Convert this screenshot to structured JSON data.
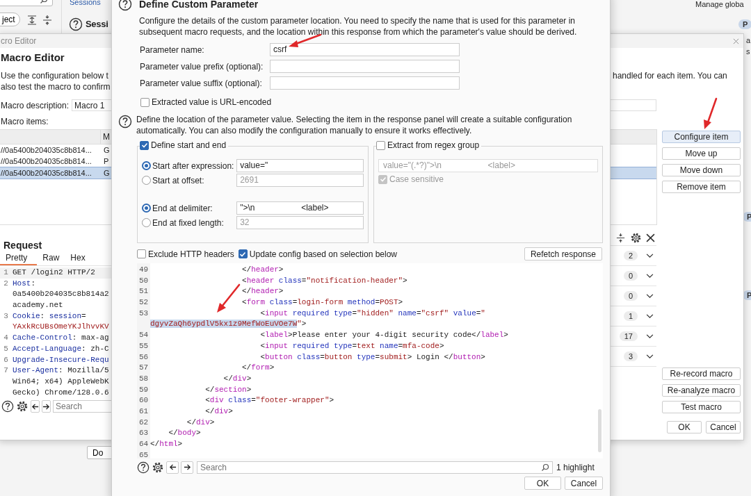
{
  "background": {
    "scope_button": "ject",
    "link": "Sessions",
    "heading": "Sessi",
    "top_right_text": "Manage globa",
    "badges": [
      "P",
      "P",
      "P"
    ],
    "side_texts": [
      "a",
      "s"
    ],
    "bottom_button": "Do"
  },
  "macro_editor": {
    "title": "cro Editor",
    "heading": "Macro Editor",
    "description_left": [
      "Use the configuration below t",
      "also test the macro to confirm"
    ],
    "description_right": "handled for each item. You can",
    "description_label": "Macro description:",
    "description_value": "Macro 1",
    "items_label": "Macro items:",
    "items_columns": [
      "M"
    ],
    "items": [
      {
        "url": "//0a5400b204035c8b814...",
        "method": "G",
        "selected": false
      },
      {
        "url": "//0a5400b204035c8b814...",
        "method": "P",
        "selected": false
      },
      {
        "url": "//0a5400b204035c8b814...",
        "method": "G",
        "selected": true
      }
    ],
    "buttons": [
      "Configure item",
      "Move up",
      "Move down",
      "Remove item"
    ],
    "lower_buttons": [
      "Re-record macro",
      "Re-analyze macro",
      "Test macro"
    ],
    "ok": "OK",
    "cancel": "Cancel",
    "counts": [
      "2",
      "0",
      "0",
      "1",
      "17",
      "3"
    ],
    "request": {
      "title": "Request",
      "tabs": [
        {
          "label": "Pretty",
          "selected": true
        },
        {
          "label": "Raw",
          "selected": false
        },
        {
          "label": "Hex",
          "selected": false
        }
      ],
      "lines": [
        {
          "num": "1",
          "tokens": [
            {
              "kind": "txt",
              "text": "GET /login2 HTTP/2"
            }
          ]
        },
        {
          "num": "2",
          "tokens": [
            {
              "kind": "name",
              "text": "Host"
            },
            {
              "kind": "txt",
              "text": ":"
            }
          ]
        },
        {
          "tokens": [
            {
              "kind": "txt",
              "text": "0a5400b204035c8b814a2"
            }
          ]
        },
        {
          "tokens": [
            {
              "kind": "txt",
              "text": "academy.net"
            }
          ]
        },
        {
          "num": "3",
          "tokens": [
            {
              "kind": "name",
              "text": "Cookie"
            },
            {
              "kind": "txt",
              "text": ": "
            },
            {
              "kind": "name",
              "text": "session"
            },
            {
              "kind": "txt",
              "text": "="
            }
          ]
        },
        {
          "tokens": [
            {
              "kind": "val",
              "text": "YAxkRcUBsOmeYKJlhvvKV"
            }
          ]
        },
        {
          "num": "4",
          "tokens": [
            {
              "kind": "name",
              "text": "Cache-Control"
            },
            {
              "kind": "txt",
              "text": ": max-ag"
            }
          ]
        },
        {
          "num": "5",
          "tokens": [
            {
              "kind": "name",
              "text": "Accept-Language"
            },
            {
              "kind": "txt",
              "text": ": zh-C"
            }
          ]
        },
        {
          "num": "6",
          "tokens": [
            {
              "kind": "name",
              "text": "Upgrade-Insecure-Requ"
            }
          ]
        },
        {
          "num": "7",
          "tokens": [
            {
              "kind": "name",
              "text": "User-Agent"
            },
            {
              "kind": "txt",
              "text": ": Mozilla/5"
            }
          ]
        },
        {
          "tokens": [
            {
              "kind": "txt",
              "text": "Win64; x64) AppleWebK"
            }
          ]
        },
        {
          "tokens": [
            {
              "kind": "txt",
              "text": "Gecko) Chrome/128.0.6"
            }
          ]
        }
      ],
      "search_placeholder": "Search"
    }
  },
  "dialog": {
    "title": "Define Custom Parameter",
    "intro": "Configure the details of the custom parameter location. You need to specify the name that is used for this parameter in subsequent macro requests, and the location within this response from which the parameter's value should be derived.",
    "fields": [
      {
        "label": "Parameter name:",
        "value": "csrf"
      },
      {
        "label": "Parameter value prefix (optional):"
      },
      {
        "label": "Parameter value suffix (optional):"
      }
    ],
    "url_encoded": {
      "label": "Extracted value is URL-encoded",
      "checked": false
    },
    "location_help": "Define the location of the parameter value. Selecting the item in the response panel will create a suitable configuration automatically. You can also modify the configuration manually to ensure it works effectively.",
    "start_end": {
      "label": "Define start and end",
      "checked": true,
      "options": [
        {
          "label": "Start after expression:",
          "selected": true,
          "value": "value=\""
        },
        {
          "label": "Start at offset:",
          "selected": false,
          "value": "2691"
        },
        {
          "label": "End at delimiter:",
          "selected": true,
          "value": "\">\\n                    <label>"
        },
        {
          "label": "End at fixed length:",
          "selected": false,
          "value": "32"
        }
      ]
    },
    "regex": {
      "label": "Extract from regex group",
      "checked": false,
      "value": "value=\"(.*?)\">\\n                    <label>",
      "case_sensitive": {
        "label": "Case sensitive",
        "checked": true
      }
    },
    "exclude_headers": {
      "label": "Exclude HTTP headers",
      "checked": false
    },
    "update_config": {
      "label": "Update config based on selection below",
      "checked": true
    },
    "refetch": "Refetch response",
    "code_lines": [
      {
        "num": "49",
        "tokens": [
          {
            "kind": "p",
            "text": "                    </"
          },
          {
            "kind": "tag",
            "text": "header"
          },
          {
            "kind": "p",
            "text": ">"
          }
        ]
      },
      {
        "num": "50",
        "tokens": [
          {
            "kind": "p",
            "text": "                    <"
          },
          {
            "kind": "tag",
            "text": "header"
          },
          {
            "kind": "attr",
            "text": " class"
          },
          {
            "kind": "p",
            "text": "="
          },
          {
            "kind": "val",
            "text": "\"notification-header\""
          },
          {
            "kind": "p",
            "text": ">"
          }
        ]
      },
      {
        "num": "51",
        "tokens": [
          {
            "kind": "p",
            "text": "                    </"
          },
          {
            "kind": "tag",
            "text": "header"
          },
          {
            "kind": "p",
            "text": ">"
          }
        ]
      },
      {
        "num": "52",
        "tokens": [
          {
            "kind": "p",
            "text": "                    <"
          },
          {
            "kind": "tag",
            "text": "form"
          },
          {
            "kind": "attr",
            "text": " class"
          },
          {
            "kind": "p",
            "text": "="
          },
          {
            "kind": "val",
            "text": "login-form"
          },
          {
            "kind": "attr",
            "text": " method"
          },
          {
            "kind": "p",
            "text": "="
          },
          {
            "kind": "val",
            "text": "POST"
          },
          {
            "kind": "p",
            "text": ">"
          }
        ]
      },
      {
        "num": "53",
        "tokens": [
          {
            "kind": "p",
            "text": "                        <"
          },
          {
            "kind": "tag",
            "text": "input"
          },
          {
            "kind": "attr",
            "text": " required type"
          },
          {
            "kind": "p",
            "text": "="
          },
          {
            "kind": "val",
            "text": "\"hidden\""
          },
          {
            "kind": "attr",
            "text": " name"
          },
          {
            "kind": "p",
            "text": "="
          },
          {
            "kind": "val",
            "text": "\"csrf\""
          },
          {
            "kind": "attr",
            "text": " value"
          },
          {
            "kind": "p",
            "text": "="
          },
          {
            "kind": "val",
            "text": "\""
          }
        ]
      },
      {
        "tokens": [
          {
            "kind": "sel",
            "text": "dgyvZaQh6ypdlV5kx1z9MefWoEuVOe7W"
          },
          {
            "kind": "val",
            "text": "\""
          },
          {
            "kind": "p",
            "text": ">"
          }
        ]
      },
      {
        "num": "54",
        "tokens": [
          {
            "kind": "p",
            "text": "                        <"
          },
          {
            "kind": "tag",
            "text": "label"
          },
          {
            "kind": "p",
            "text": ">Please enter your 4-digit security code</"
          },
          {
            "kind": "tag",
            "text": "label"
          },
          {
            "kind": "p",
            "text": ">"
          }
        ]
      },
      {
        "num": "55",
        "tokens": [
          {
            "kind": "p",
            "text": "                        <"
          },
          {
            "kind": "tag",
            "text": "input"
          },
          {
            "kind": "attr",
            "text": " required type"
          },
          {
            "kind": "p",
            "text": "="
          },
          {
            "kind": "val",
            "text": "text"
          },
          {
            "kind": "attr",
            "text": " name"
          },
          {
            "kind": "p",
            "text": "="
          },
          {
            "kind": "val",
            "text": "mfa-code"
          },
          {
            "kind": "p",
            "text": ">"
          }
        ]
      },
      {
        "num": "56",
        "tokens": [
          {
            "kind": "p",
            "text": "                        <"
          },
          {
            "kind": "tag",
            "text": "button"
          },
          {
            "kind": "attr",
            "text": " class"
          },
          {
            "kind": "p",
            "text": "="
          },
          {
            "kind": "val",
            "text": "button"
          },
          {
            "kind": "attr",
            "text": " type"
          },
          {
            "kind": "p",
            "text": "="
          },
          {
            "kind": "val",
            "text": "submit"
          },
          {
            "kind": "p",
            "text": "> Login </"
          },
          {
            "kind": "tag",
            "text": "button"
          },
          {
            "kind": "p",
            "text": ">"
          }
        ]
      },
      {
        "num": "57",
        "tokens": [
          {
            "kind": "p",
            "text": "                    </"
          },
          {
            "kind": "tag",
            "text": "form"
          },
          {
            "kind": "p",
            "text": ">"
          }
        ]
      },
      {
        "num": "58",
        "tokens": [
          {
            "kind": "p",
            "text": "                </"
          },
          {
            "kind": "tag",
            "text": "div"
          },
          {
            "kind": "p",
            "text": ">"
          }
        ]
      },
      {
        "num": "59",
        "tokens": [
          {
            "kind": "p",
            "text": "            </"
          },
          {
            "kind": "tag",
            "text": "section"
          },
          {
            "kind": "p",
            "text": ">"
          }
        ]
      },
      {
        "num": "60",
        "tokens": [
          {
            "kind": "p",
            "text": "            <"
          },
          {
            "kind": "tag",
            "text": "div"
          },
          {
            "kind": "attr",
            "text": " class"
          },
          {
            "kind": "p",
            "text": "="
          },
          {
            "kind": "val",
            "text": "\"footer-wrapper\""
          },
          {
            "kind": "p",
            "text": ">"
          }
        ]
      },
      {
        "num": "61",
        "tokens": [
          {
            "kind": "p",
            "text": "            </"
          },
          {
            "kind": "tag",
            "text": "div"
          },
          {
            "kind": "p",
            "text": ">"
          }
        ]
      },
      {
        "num": "62",
        "tokens": [
          {
            "kind": "p",
            "text": "        </"
          },
          {
            "kind": "tag",
            "text": "div"
          },
          {
            "kind": "p",
            "text": ">"
          }
        ]
      },
      {
        "num": "63",
        "tokens": [
          {
            "kind": "p",
            "text": "    </"
          },
          {
            "kind": "tag",
            "text": "body"
          },
          {
            "kind": "p",
            "text": ">"
          }
        ]
      },
      {
        "num": "64",
        "tokens": [
          {
            "kind": "p",
            "text": "</"
          },
          {
            "kind": "tag",
            "text": "html"
          },
          {
            "kind": "p",
            "text": ">"
          }
        ]
      },
      {
        "num": "65"
      }
    ],
    "search_placeholder": "Search",
    "highlight_count": "1 highlight",
    "ok": "OK",
    "cancel": "Cancel"
  }
}
